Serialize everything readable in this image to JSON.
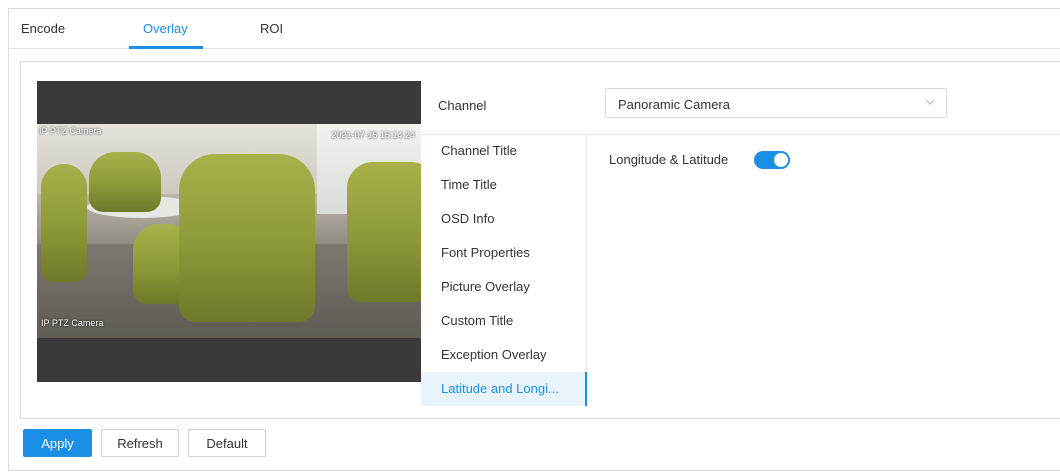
{
  "tabs": [
    {
      "label": "Encode",
      "active": false
    },
    {
      "label": "Overlay",
      "active": true
    },
    {
      "label": "ROI",
      "active": false
    }
  ],
  "preview": {
    "osd_top_left": "IP PTZ Camera",
    "osd_top_right": "2021-07-15 15:14:24",
    "osd_bottom_left": "IP PTZ Camera"
  },
  "channel": {
    "label": "Channel",
    "value": "Panoramic Camera",
    "icon": "chevron-down-icon"
  },
  "menu": {
    "items": [
      "Channel Title",
      "Time Title",
      "OSD Info",
      "Font Properties",
      "Picture Overlay",
      "Custom Title",
      "Exception Overlay",
      "Latitude and Longi..."
    ],
    "active_index": 7
  },
  "setting": {
    "label": "Longitude & Latitude",
    "enabled": true
  },
  "buttons": {
    "apply": "Apply",
    "refresh": "Refresh",
    "default": "Default"
  },
  "colors": {
    "accent": "#1b8ee6",
    "active_menu_bg": "#e8f3fc"
  }
}
